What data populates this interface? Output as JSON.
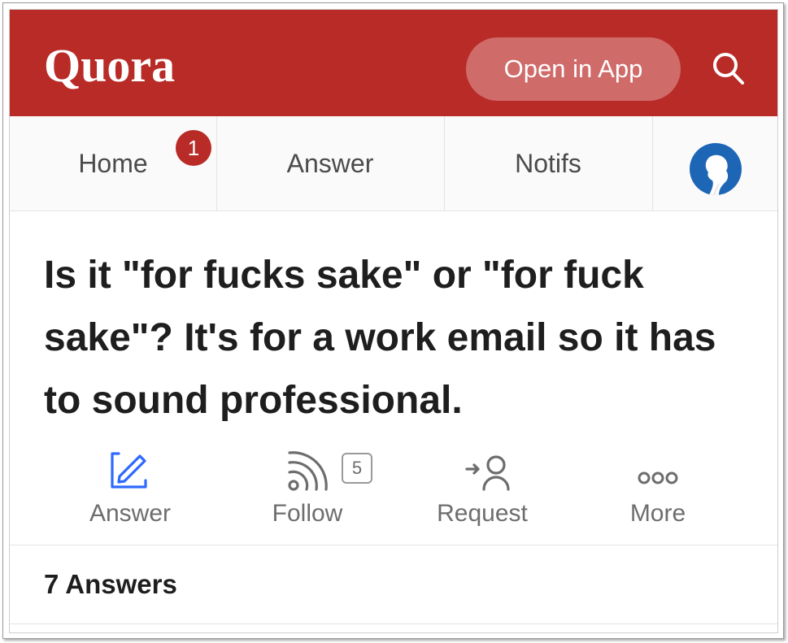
{
  "header": {
    "logo": "Quora",
    "open_in_app": "Open in App",
    "search_icon": "search-icon",
    "brand_color": "#b92b27"
  },
  "nav": {
    "items": [
      {
        "label": "Home",
        "badge": "1"
      },
      {
        "label": "Answer"
      },
      {
        "label": "Notifs"
      }
    ],
    "avatar_icon": "profile-avatar"
  },
  "question": {
    "title": "Is it \"for fucks sake\" or \"for fuck sake\"? It's for a work email so it has to sound professional."
  },
  "actions": [
    {
      "label": "Answer",
      "icon": "pencil-square-icon"
    },
    {
      "label": "Follow",
      "icon": "rss-feed-icon",
      "count": "5"
    },
    {
      "label": "Request",
      "icon": "request-user-icon"
    },
    {
      "label": "More",
      "icon": "more-dots-icon"
    }
  ],
  "answers": {
    "count_label": "7 Answers"
  }
}
